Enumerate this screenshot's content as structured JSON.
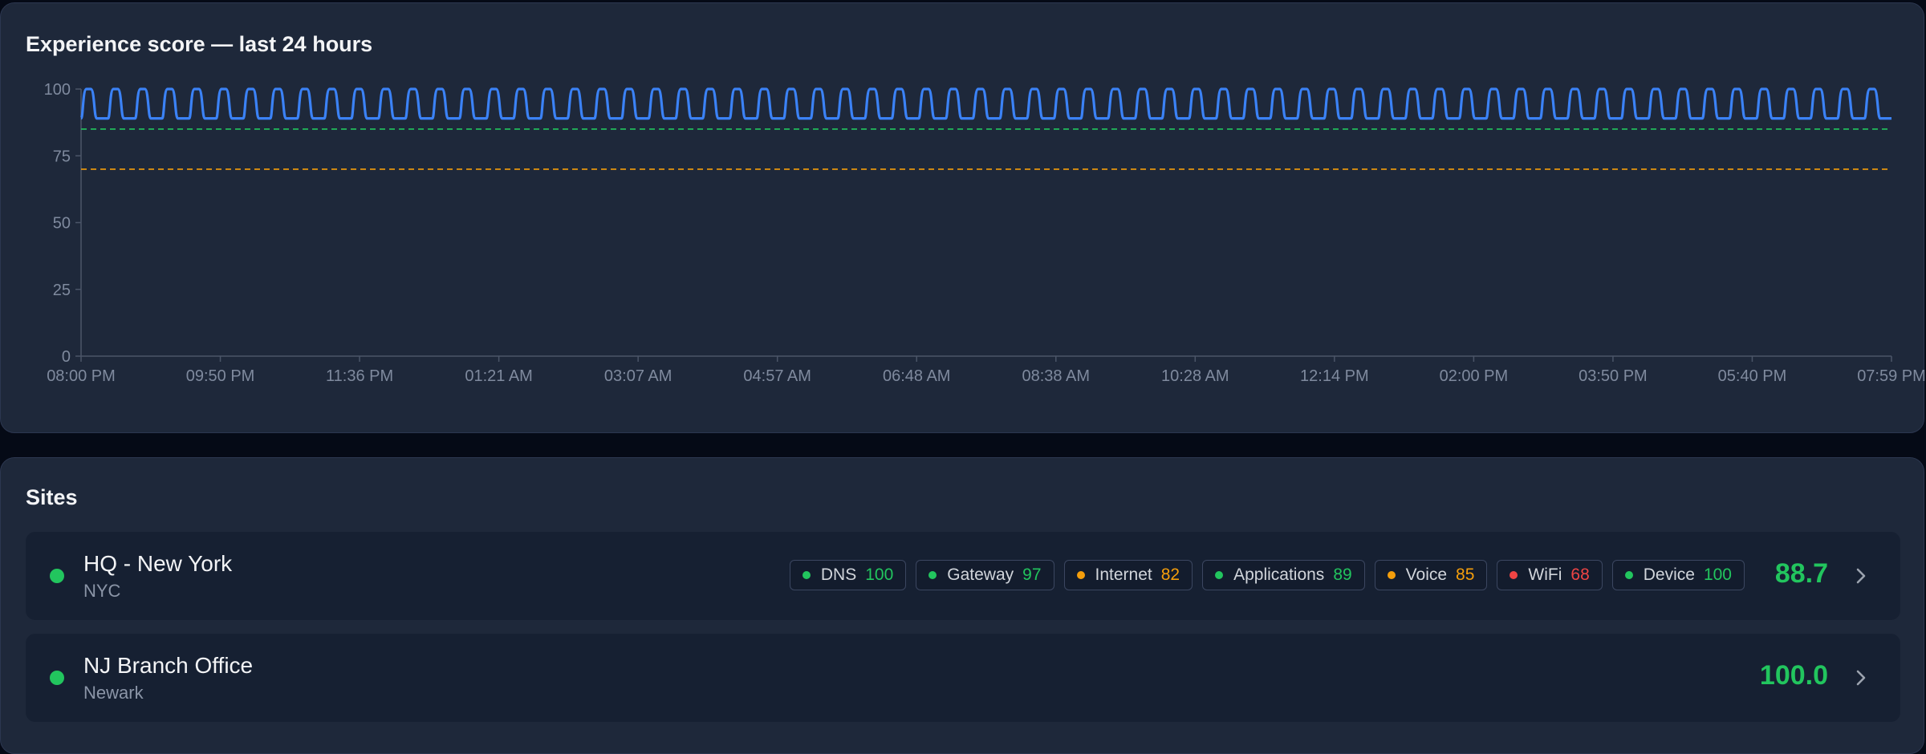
{
  "colors": {
    "line": "#3b82f6",
    "good": "#22c55e",
    "warn": "#f59e0b",
    "bad": "#ef4444"
  },
  "chart": {
    "title": "Experience score — last 24 hours"
  },
  "chart_data": {
    "type": "line",
    "title": "Experience score — last 24 hours",
    "xlabel": "",
    "ylabel": "",
    "ylim": [
      0,
      100
    ],
    "y_ticks": [
      0,
      25,
      50,
      75,
      100
    ],
    "x_tick_labels": [
      "08:00 PM",
      "09:50 PM",
      "11:36 PM",
      "01:21 AM",
      "03:07 AM",
      "04:57 AM",
      "06:48 AM",
      "08:38 AM",
      "10:28 AM",
      "12:14 PM",
      "02:00 PM",
      "03:50 PM",
      "05:40 PM",
      "07:59 PM"
    ],
    "series": [
      {
        "color": "#3b82f6",
        "pattern": "periodic oscillation between ~89 and ~100",
        "values": [
          100,
          89,
          100,
          89,
          100,
          89,
          100,
          89,
          100,
          89,
          100,
          89,
          100,
          89,
          100,
          89,
          100,
          89,
          100,
          89,
          100,
          89,
          100,
          89,
          100,
          89,
          100,
          89,
          100,
          89,
          100,
          89,
          100,
          89,
          100,
          89,
          100,
          89,
          100,
          89,
          100,
          89,
          100,
          89,
          100,
          89,
          100,
          89,
          100,
          89,
          100,
          89,
          100,
          89,
          100,
          89,
          100,
          89,
          100,
          89,
          100,
          89,
          100,
          89,
          100,
          89,
          100,
          89,
          100,
          89,
          100,
          89,
          100,
          89,
          100,
          89,
          100,
          89,
          100,
          89,
          100,
          89,
          100,
          89,
          100,
          89,
          100,
          89,
          100,
          89,
          100,
          89,
          100,
          89,
          100,
          89,
          100,
          89,
          100,
          89,
          100,
          89,
          100,
          89,
          100,
          89,
          100,
          89,
          100,
          89,
          100,
          89,
          100,
          89,
          100,
          89,
          100,
          89,
          100,
          89,
          100,
          89,
          100,
          89,
          100,
          89,
          100,
          89,
          100,
          89,
          100,
          89,
          100,
          89
        ]
      }
    ],
    "thresholds": [
      {
        "value": 85,
        "color": "#22c55e",
        "style": "dashed"
      },
      {
        "value": 70,
        "color": "#f59e0b",
        "style": "dashed"
      }
    ],
    "grid": false
  },
  "sites": {
    "title": "Sites",
    "items": [
      {
        "name": "HQ - New York",
        "city": "NYC",
        "score": "88.7",
        "metrics": [
          {
            "label": "DNS",
            "value": "100",
            "status": "good"
          },
          {
            "label": "Gateway",
            "value": "97",
            "status": "good"
          },
          {
            "label": "Internet",
            "value": "82",
            "status": "warn"
          },
          {
            "label": "Applications",
            "value": "89",
            "status": "good"
          },
          {
            "label": "Voice",
            "value": "85",
            "status": "warn"
          },
          {
            "label": "WiFi",
            "value": "68",
            "status": "bad"
          },
          {
            "label": "Device",
            "value": "100",
            "status": "good"
          }
        ]
      },
      {
        "name": "NJ Branch Office",
        "city": "Newark",
        "score": "100.0",
        "metrics": []
      }
    ]
  }
}
